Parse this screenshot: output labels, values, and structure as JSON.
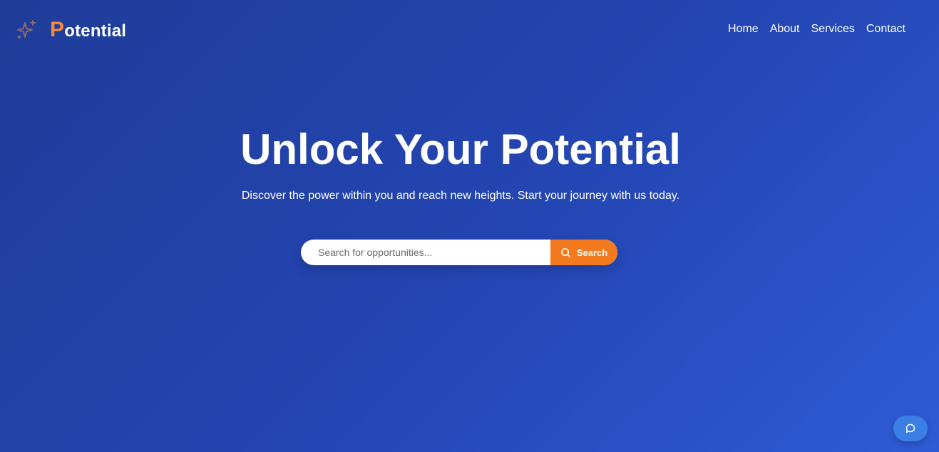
{
  "logo": {
    "first_letter": "P",
    "rest": "otential",
    "icon": "sparkle-icon",
    "accent_color": "#f58a3c"
  },
  "nav": {
    "items": [
      {
        "label": "Home"
      },
      {
        "label": "About"
      },
      {
        "label": "Services"
      },
      {
        "label": "Contact"
      }
    ]
  },
  "hero": {
    "title": "Unlock Your Potential",
    "subtitle": "Discover the power within you and reach new heights. Start your journey with us today."
  },
  "search": {
    "placeholder": "Search for opportunities...",
    "value": "",
    "button_label": "Search",
    "button_icon": "search-icon",
    "button_color": "#f47a1f"
  },
  "chat": {
    "icon": "chat-bubble-icon",
    "color": "#3b7fe6"
  },
  "colors": {
    "background_start": "#1f3c98",
    "background_end": "#2f5bd6"
  }
}
